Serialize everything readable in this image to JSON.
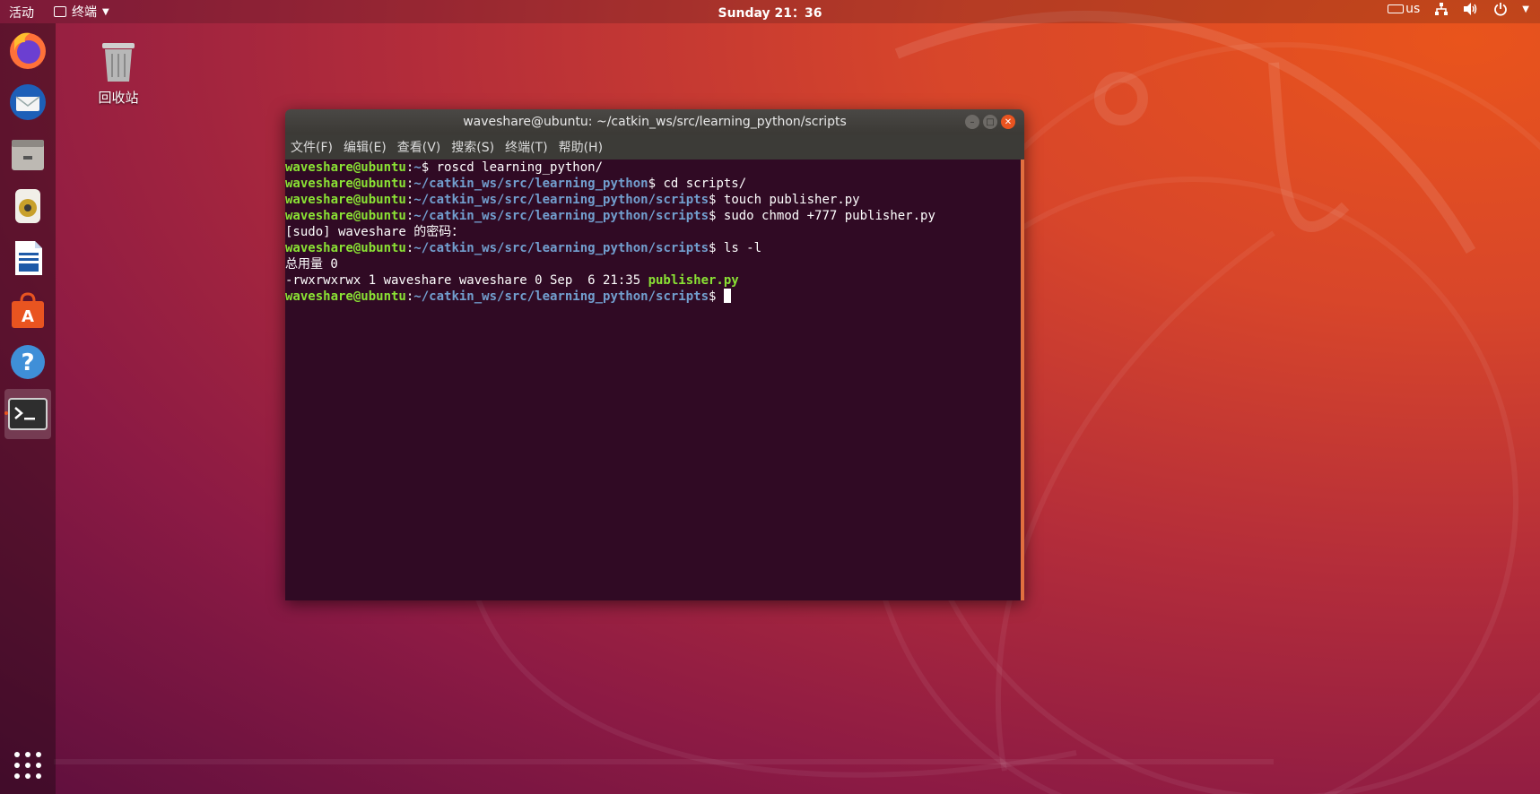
{
  "topbar": {
    "activities": "活动",
    "app_menu": "终端",
    "clock": "Sunday 21：36",
    "keyboard_layout": "us"
  },
  "desktop": {
    "trash_label": "回收站"
  },
  "dock": {
    "items": [
      {
        "name": "firefox-icon"
      },
      {
        "name": "thunderbird-icon"
      },
      {
        "name": "files-icon"
      },
      {
        "name": "rhythmbox-icon"
      },
      {
        "name": "libreoffice-writer-icon"
      },
      {
        "name": "software-center-icon"
      },
      {
        "name": "help-icon"
      },
      {
        "name": "terminal-icon",
        "active": true
      }
    ]
  },
  "terminal": {
    "title": "waveshare@ubuntu: ~/catkin_ws/src/learning_python/scripts",
    "menu": [
      "文件(F)",
      "编辑(E)",
      "查看(V)",
      "搜索(S)",
      "终端(T)",
      "帮助(H)"
    ],
    "user_host": "waveshare@ubuntu",
    "lines": [
      {
        "path": "~",
        "cmd": "$ roscd learning_python/"
      },
      {
        "path": "~/catkin_ws/src/learning_python",
        "cmd": "$ cd scripts/"
      },
      {
        "path": "~/catkin_ws/src/learning_python/scripts",
        "cmd": "$ touch publisher.py"
      },
      {
        "path": "~/catkin_ws/src/learning_python/scripts",
        "cmd": "$ sudo chmod +777 publisher.py"
      },
      {
        "output": "[sudo] waveshare 的密码："
      },
      {
        "path": "~/catkin_ws/src/learning_python/scripts",
        "cmd": "$ ls -l"
      },
      {
        "output": "总用量 0"
      },
      {
        "output": "-rwxrwxrwx 1 waveshare waveshare 0 Sep  6 21:35 ",
        "highlight": "publisher.py"
      },
      {
        "path": "~/catkin_ws/src/learning_python/scripts",
        "cmd": "$ ",
        "cursor": true
      }
    ]
  },
  "colors": {
    "terminal_bg": "#300a24",
    "prompt_user": "#8ae234",
    "prompt_path": "#729fcf",
    "accent": "#e95420"
  }
}
